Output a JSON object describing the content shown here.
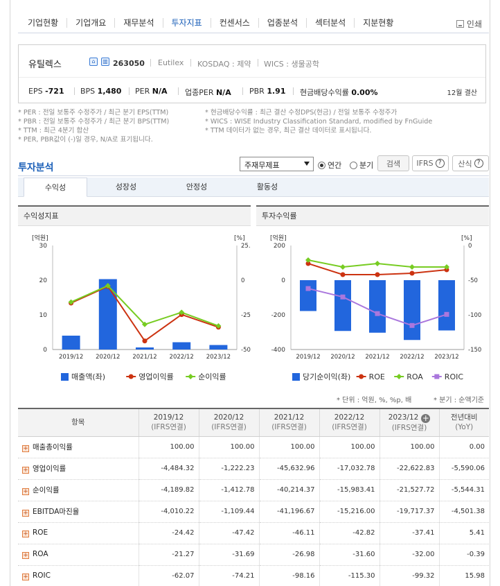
{
  "nav": {
    "items": [
      "기업현황",
      "기업개요",
      "재무분석",
      "투자지표",
      "컨센서스",
      "업종분석",
      "섹터분석",
      "지분현황"
    ],
    "active_index": 3,
    "print_label": "인쇄"
  },
  "company": {
    "name": "유틸렉스",
    "code": "263050",
    "english": "Eutilex",
    "market": "KOSDAQ : 제약",
    "wics": "WICS : 생물공학",
    "metrics": [
      {
        "label": "EPS",
        "value": "-721"
      },
      {
        "label": "BPS",
        "value": "1,480"
      },
      {
        "label": "PER",
        "value": "N/A"
      },
      {
        "label": "업종PER",
        "value": "N/A"
      },
      {
        "label": "PBR",
        "value": "1.91"
      },
      {
        "label": "현금배당수익률",
        "value": "0.00%"
      }
    ],
    "settlement": "12월 결산"
  },
  "notes": {
    "left": [
      "* PER : 전일 보통주 수정주가 / 최근 분기 EPS(TTM)",
      "* PBR : 전일 보통주 수정주가 / 최근 분기 BPS(TTM)",
      "* TTM : 최근 4분기 합산",
      "* PER, PBR값이 (-)일 경우, N/A로 표기됩니다."
    ],
    "right": [
      "* 현금배당수익률 : 최근 결산 수정DPS(현금) / 전일 보통주 수정주가",
      "* WICS : WISE Industry Classification Standard, modified by FnGuide",
      "* TTM 데이터가 없는 경우, 최근 결산 데이터로 표시됩니다."
    ]
  },
  "analysis": {
    "title": "투자분석",
    "select_value": "주재무제표",
    "radio_annual": "연간",
    "radio_quarter": "분기",
    "search_button": "검색",
    "ifrs_button": "IFRS",
    "formula_button": "산식",
    "help_glyph": "?",
    "tabs": [
      "수익성",
      "성장성",
      "안정성",
      "활동성"
    ]
  },
  "charts": {
    "left_title": "수익성지표",
    "right_title": "투자수익률",
    "left_unit_left": "[억원]",
    "left_unit_right": "[%]",
    "right_unit_left": "[억원]",
    "right_unit_right": "[%]"
  },
  "colors": {
    "bar": "#2266dd",
    "red": "#cc3311",
    "green": "#77cc22",
    "purple": "#aa77dd",
    "accent": "#1b5fb8"
  },
  "chart_data": [
    {
      "type": "bar",
      "title": "수익성지표",
      "categories": [
        "2019/12",
        "2020/12",
        "2021/12",
        "2022/12",
        "2023/12"
      ],
      "left_axis": {
        "ticks": [
          "0",
          "10",
          "20",
          "30"
        ],
        "range": [
          0,
          30
        ]
      },
      "right_axis": {
        "ticks": [
          "25.0",
          "0",
          "-25.",
          "-50."
        ],
        "range": [
          -50,
          25
        ]
      },
      "series": [
        {
          "name": "매출액(좌)",
          "kind": "bar",
          "axis": "left",
          "values": [
            4.0,
            20.3,
            0.6,
            2.1,
            1.3
          ]
        },
        {
          "name": "영업이익률",
          "kind": "line",
          "axis": "right",
          "values": [
            -4484.32,
            -1222.23,
            -45632.96,
            -17032.78,
            -22622.83
          ],
          "display_values": [
            -16.5,
            -4.5,
            -43.8,
            -24.8,
            -33.9
          ]
        },
        {
          "name": "순이익률",
          "kind": "line",
          "axis": "right",
          "values": [
            -4189.82,
            -1412.78,
            -40214.37,
            -15983.41,
            -21527.72
          ],
          "display_values": [
            -15.8,
            -4.0,
            -31.9,
            -23.2,
            -33.0
          ]
        }
      ]
    },
    {
      "type": "bar",
      "title": "투자수익률",
      "categories": [
        "2019/12",
        "2020/12",
        "2021/12",
        "2022/12",
        "2023/12"
      ],
      "left_axis": {
        "ticks": [
          "200",
          "0",
          "-200",
          "-400"
        ],
        "range": [
          -400,
          200
        ]
      },
      "right_axis": {
        "ticks": [
          "0",
          "-50",
          "-100",
          "-150"
        ],
        "range": [
          -150,
          0
        ]
      },
      "series": [
        {
          "name": "당기순이익(좌)",
          "kind": "bar",
          "axis": "left",
          "values": [
            -178,
            -293,
            -303,
            -345,
            -290
          ]
        },
        {
          "name": "ROE",
          "kind": "line",
          "axis": "right",
          "values": [
            -24.42,
            -47.42,
            -46.11,
            -42.82,
            -37.41
          ],
          "display_values": [
            -26,
            -42,
            -42,
            -40,
            -35
          ]
        },
        {
          "name": "ROA",
          "kind": "line",
          "axis": "right",
          "values": [
            -21.27,
            -31.69,
            -26.98,
            -31.6,
            -32.0
          ],
          "display_values": [
            -21,
            -31,
            -26,
            -31,
            -31
          ]
        },
        {
          "name": "ROIC",
          "kind": "line",
          "axis": "right",
          "values": [
            -62.07,
            -74.21,
            -98.16,
            -115.3,
            -99.32
          ]
        }
      ]
    }
  ],
  "table": {
    "units_note": "* 단위 : 억원, %, %p, 배",
    "quarter_note": "* 분기 : 순액기준",
    "header_item": "항목",
    "columns": [
      {
        "year": "2019/12",
        "basis": "(IFRS연결)"
      },
      {
        "year": "2020/12",
        "basis": "(IFRS연결)"
      },
      {
        "year": "2021/12",
        "basis": "(IFRS연결)"
      },
      {
        "year": "2022/12",
        "basis": "(IFRS연결)"
      },
      {
        "year": "2023/12",
        "basis": "(IFRS연결)"
      }
    ],
    "yoy_header": "전년대비",
    "yoy_sub": "(YoY)",
    "rows": [
      {
        "label": "매출총이익률",
        "values": [
          "100.00",
          "100.00",
          "100.00",
          "100.00",
          "100.00"
        ],
        "yoy": "0.00"
      },
      {
        "label": "영업이익률",
        "values": [
          "-4,484.32",
          "-1,222.23",
          "-45,632.96",
          "-17,032.78",
          "-22,622.83"
        ],
        "yoy": "-5,590.06"
      },
      {
        "label": "순이익률",
        "values": [
          "-4,189.82",
          "-1,412.78",
          "-40,214.37",
          "-15,983.41",
          "-21,527.72"
        ],
        "yoy": "-5,544.31"
      },
      {
        "label": "EBITDA마진율",
        "values": [
          "-4,010.22",
          "-1,109.44",
          "-41,196.67",
          "-15,216.00",
          "-19,717.37"
        ],
        "yoy": "-4,501.38"
      },
      {
        "label": "ROE",
        "values": [
          "-24.42",
          "-47.42",
          "-46.11",
          "-42.82",
          "-37.41"
        ],
        "yoy": "5.41"
      },
      {
        "label": "ROA",
        "values": [
          "-21.27",
          "-31.69",
          "-26.98",
          "-31.60",
          "-32.00"
        ],
        "yoy": "-0.39"
      },
      {
        "label": "ROIC",
        "values": [
          "-62.07",
          "-74.21",
          "-98.16",
          "-115.30",
          "-99.32"
        ],
        "yoy": "15.98"
      }
    ]
  }
}
